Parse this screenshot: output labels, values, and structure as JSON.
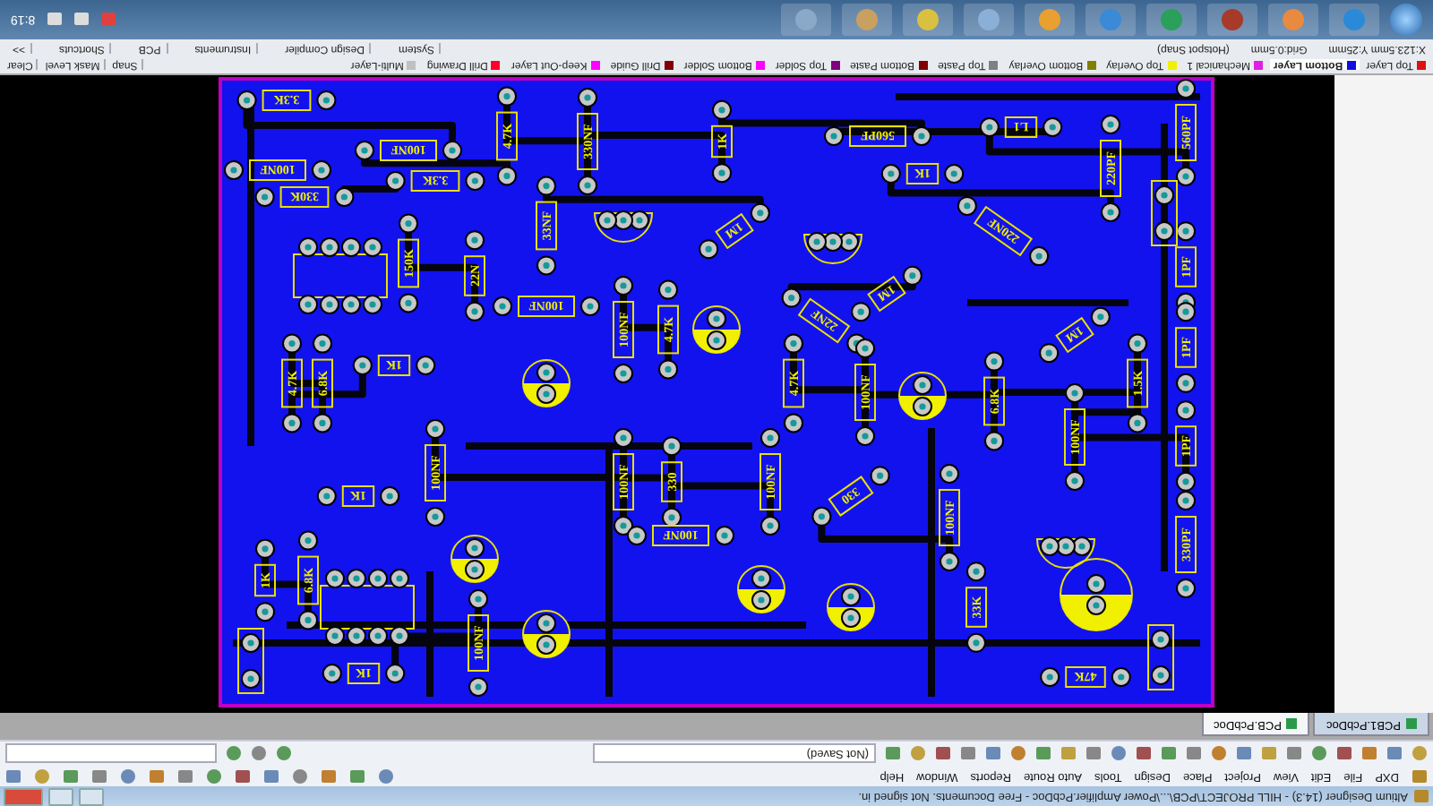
{
  "title_bar": {
    "title": "Altium Designer (14.3) - HILL PROJECT\\PCB\\...\\Power Amplifier.PcbDoc - Free Documents. Not signed in."
  },
  "menu_bar": {
    "items": [
      "DXP",
      "File",
      "Edit",
      "View",
      "Project",
      "Place",
      "Design",
      "Tools",
      "Auto Route",
      "Reports",
      "Window",
      "Help"
    ]
  },
  "toolbar": {
    "document_selector": "(Not Saved)"
  },
  "document_tabs": [
    {
      "label": "PCB1.PcbDoc",
      "selected": false
    },
    {
      "label": "PCB.PcbDoc",
      "selected": true
    }
  ],
  "pcb": {
    "components": [
      {
        "label": "3.3K"
      },
      {
        "label": "100NF"
      },
      {
        "label": "4.7K"
      },
      {
        "label": "330NF"
      },
      {
        "label": "1K"
      },
      {
        "label": "560PF"
      },
      {
        "label": "L1"
      },
      {
        "label": "560PF"
      },
      {
        "label": "100NF"
      },
      {
        "label": "3.3K"
      },
      {
        "label": "330K"
      },
      {
        "label": "1K"
      },
      {
        "label": "220PF"
      },
      {
        "label": "33NF"
      },
      {
        "label": "1M"
      },
      {
        "label": "220NF"
      },
      {
        "label": "150K"
      },
      {
        "label": "22N"
      },
      {
        "label": "1PF"
      },
      {
        "label": "100NF"
      },
      {
        "label": "22NF"
      },
      {
        "label": "1M"
      },
      {
        "label": "1M"
      },
      {
        "label": "100NF"
      },
      {
        "label": "4.7K"
      },
      {
        "label": "1PF"
      },
      {
        "label": "1K"
      },
      {
        "label": "4.7K"
      },
      {
        "label": "6.8K"
      },
      {
        "label": "4.7K"
      },
      {
        "label": "100NF"
      },
      {
        "label": "6.8K"
      },
      {
        "label": "1.5K"
      },
      {
        "label": "100NF"
      },
      {
        "label": "1PF"
      },
      {
        "label": "100NF"
      },
      {
        "label": "100NF"
      },
      {
        "label": "330"
      },
      {
        "label": "100NF"
      },
      {
        "label": "1K"
      },
      {
        "label": "330"
      },
      {
        "label": "100NF"
      },
      {
        "label": "100NF"
      },
      {
        "label": "330PF"
      },
      {
        "label": "1K"
      },
      {
        "label": "6.8K"
      },
      {
        "label": "33K"
      },
      {
        "label": "100NF"
      },
      {
        "label": "1K"
      },
      {
        "label": "47K"
      }
    ]
  },
  "layer_tabs": [
    {
      "label": "Top Layer",
      "color": "#e01010",
      "selected": false
    },
    {
      "label": "Bottom Layer",
      "color": "#1010e0",
      "selected": true
    },
    {
      "label": "Mechanical 1",
      "color": "#e020e0",
      "selected": false
    },
    {
      "label": "Top Overlay",
      "color": "#f0f000",
      "selected": false
    },
    {
      "label": "Bottom Overlay",
      "color": "#808000",
      "selected": false
    },
    {
      "label": "Top Paste",
      "color": "#808080",
      "selected": false
    },
    {
      "label": "Bottom Paste",
      "color": "#800000",
      "selected": false
    },
    {
      "label": "Top Solder",
      "color": "#800080",
      "selected": false
    },
    {
      "label": "Bottom Solder",
      "color": "#ff00ff",
      "selected": false
    },
    {
      "label": "Drill Guide",
      "color": "#800000",
      "selected": false
    },
    {
      "label": "Keep-Out Layer",
      "color": "#ff00ff",
      "selected": false
    },
    {
      "label": "Drill Drawing",
      "color": "#ff0028",
      "selected": false
    },
    {
      "label": "Multi-Layer",
      "color": "#c0c0c0",
      "selected": false
    }
  ],
  "layer_controls": [
    "Snap",
    "Mask Level",
    "Clear"
  ],
  "status_bar": {
    "coordinates": "X:123.5mm Y:25mm",
    "grid": "Grid:0.5mm",
    "snap_mode": "(Hotspot Snap)",
    "panels": [
      "System",
      "Design Compiler",
      "Instruments",
      "PCB",
      "Shortcuts",
      ">>"
    ]
  },
  "taskbar": {
    "clock": "8:19"
  }
}
